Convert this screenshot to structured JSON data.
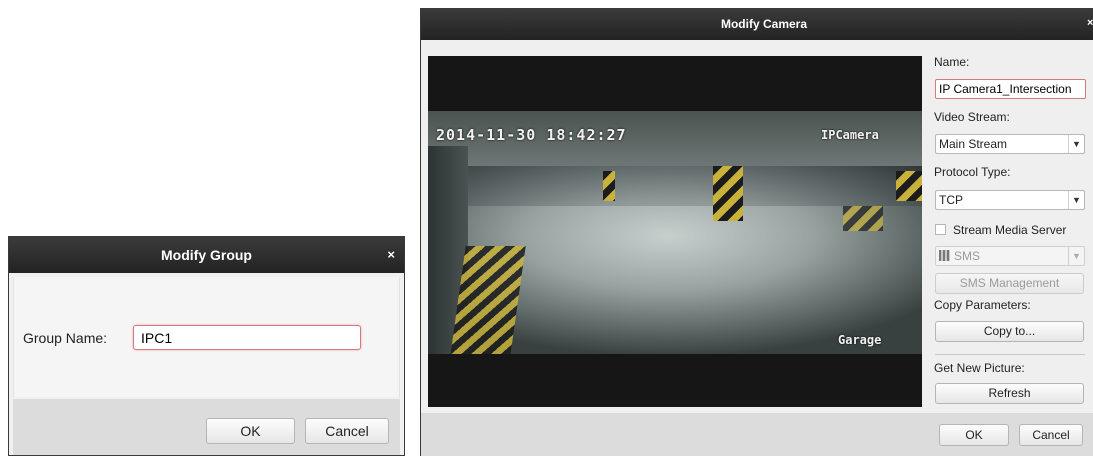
{
  "modify_group": {
    "title": "Modify Group",
    "group_name_label": "Group Name:",
    "group_name_value": "IPC1",
    "ok_label": "OK",
    "cancel_label": "Cancel"
  },
  "modify_camera": {
    "title": "Modify Camera",
    "video_osd": {
      "timestamp": "2014-11-30 18:42:27",
      "camera_label": "IPCamera",
      "location_label": "Garage"
    },
    "name_label": "Name:",
    "name_value": "IP Camera1_Intersection",
    "video_stream_label": "Video Stream:",
    "video_stream_value": "Main Stream",
    "protocol_type_label": "Protocol Type:",
    "protocol_type_value": "TCP",
    "stream_media_server_label": "Stream Media Server",
    "stream_media_server_checked": false,
    "sms_select_value": "SMS",
    "sms_management_label": "SMS Management",
    "copy_parameters_label": "Copy Parameters:",
    "copy_to_label": "Copy to...",
    "get_new_picture_label": "Get New Picture:",
    "refresh_label": "Refresh",
    "ok_label": "OK",
    "cancel_label": "Cancel"
  },
  "colors": {
    "titlebar": "#2b2b2b",
    "dialog_bg": "#efefef",
    "footer_bg": "#dcdcdc",
    "focus_border": "#d47a7a"
  }
}
